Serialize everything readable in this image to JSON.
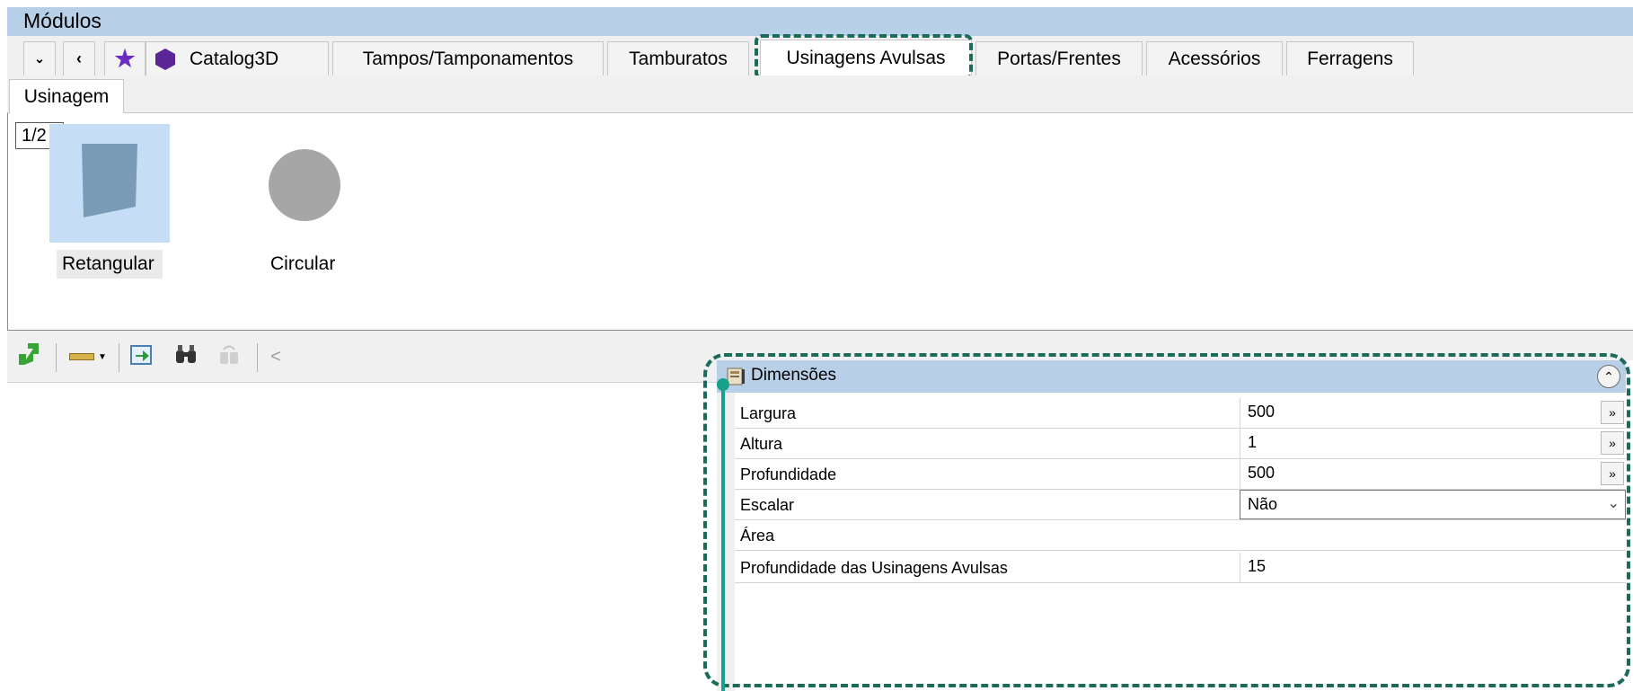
{
  "window": {
    "title": "Módulos"
  },
  "tabs": [
    {
      "label": "Catalog3D"
    },
    {
      "label": "Tampos/Tamponamentos"
    },
    {
      "label": "Tamburatos"
    },
    {
      "label": "Usinagens Avulsas",
      "active": true
    },
    {
      "label": "Portas/Frentes"
    },
    {
      "label": "Acessórios"
    },
    {
      "label": "Ferragens"
    }
  ],
  "subtabs": [
    {
      "label": "Usinagem"
    }
  ],
  "catalog": {
    "page_indicator": "1/2",
    "items": [
      {
        "label": "Retangular",
        "selected": true
      },
      {
        "label": "Circular",
        "selected": false
      }
    ]
  },
  "toolbar": {
    "back_glyph": "<"
  },
  "properties": {
    "group_title": "Dimensões",
    "rows": [
      {
        "name": "Largura",
        "value": "500",
        "more": "»"
      },
      {
        "name": "Altura",
        "value": "1",
        "more": "»"
      },
      {
        "name": "Profundidade",
        "value": "500",
        "more": "»"
      },
      {
        "name": "Escalar",
        "value": "Não"
      },
      {
        "name": "Área",
        "value": ""
      },
      {
        "name": "Profundidade das Usinagens Avulsas",
        "value": "15"
      }
    ]
  },
  "colors": {
    "header_blue": "#b8cfe8",
    "selection_blue": "#c5def5",
    "highlight_green": "#1a6b5a",
    "accent_teal": "#17a08a",
    "star_purple": "#6a2bc2"
  }
}
